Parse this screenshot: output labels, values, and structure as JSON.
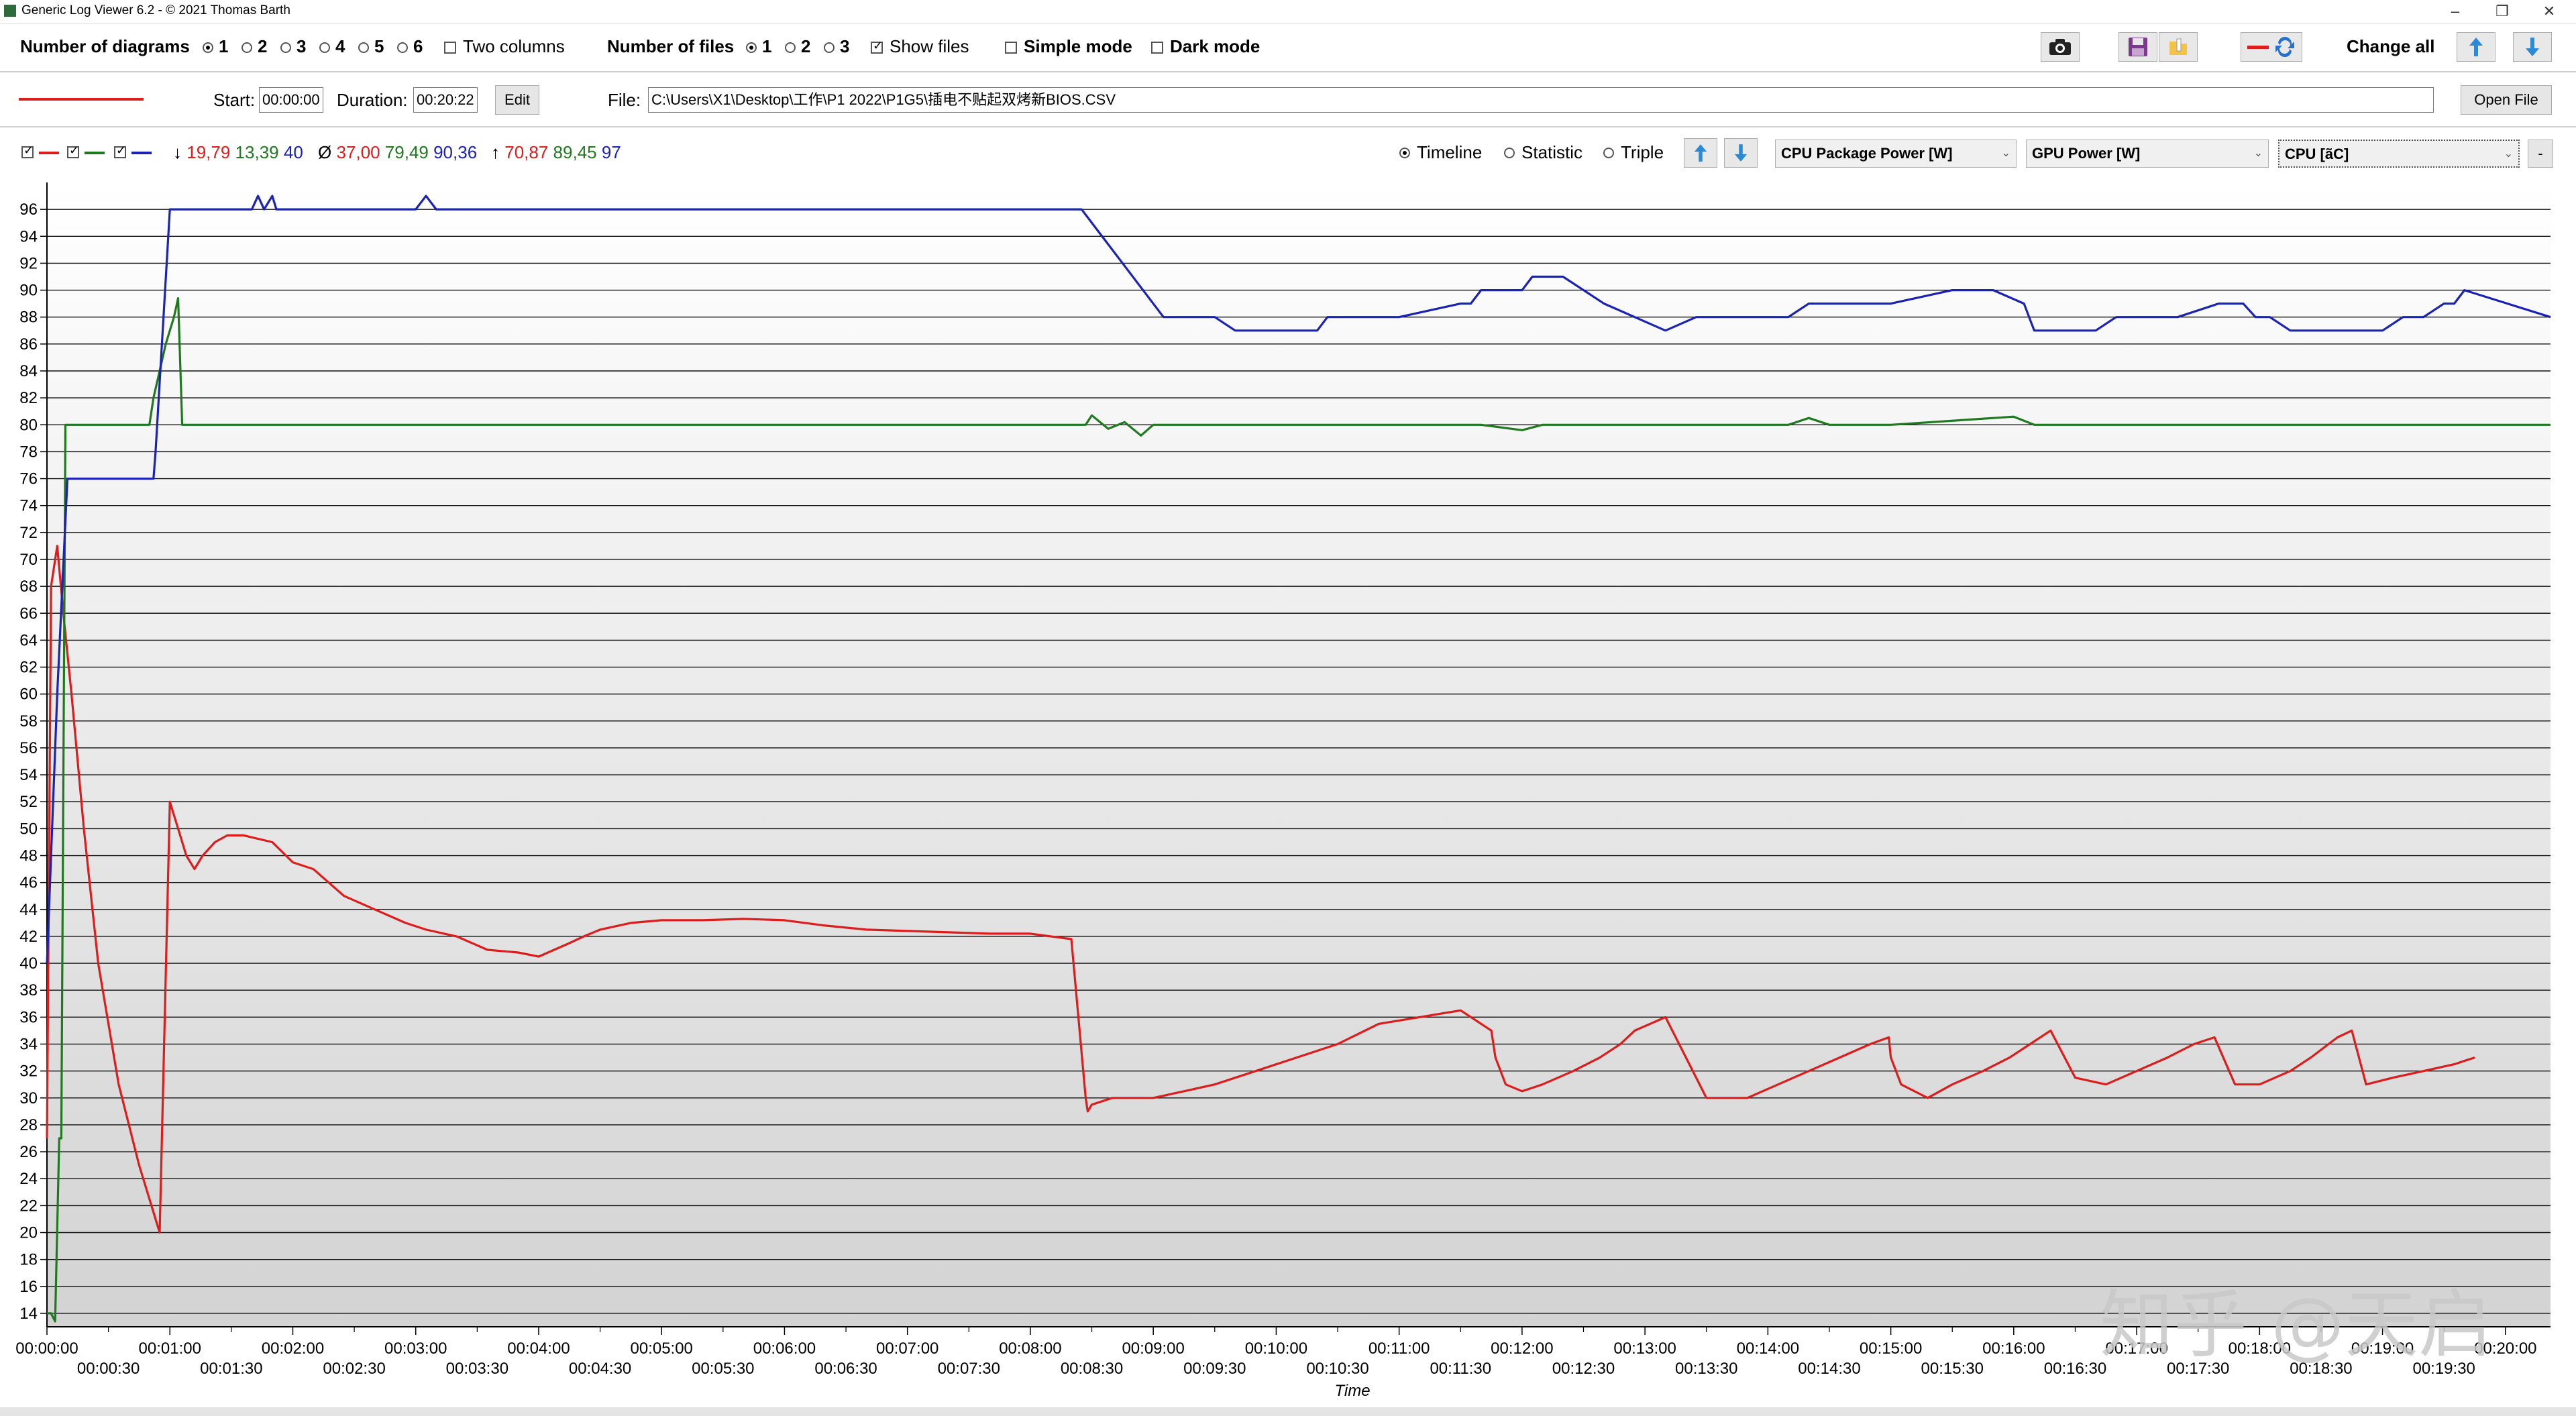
{
  "window": {
    "title": "Generic Log Viewer 6.2 - © 2021 Thomas Barth",
    "minimize": "–",
    "restore": "❐",
    "close": "✕"
  },
  "toolbar": {
    "diagrams_label": "Number of diagrams",
    "diagram_options": [
      "1",
      "2",
      "3",
      "4",
      "5",
      "6"
    ],
    "diagram_selected": "1",
    "two_columns_label": "Two columns",
    "files_label": "Number of files",
    "file_options": [
      "1",
      "2",
      "3"
    ],
    "file_selected": "1",
    "show_files_label": "Show files",
    "simple_mode_label": "Simple mode",
    "dark_mode_label": "Dark mode",
    "change_all_label": "Change all"
  },
  "file_row": {
    "line_color": "#dd1c1c",
    "start_label": "Start:",
    "start_value": "00:00:00",
    "duration_label": "Duration:",
    "duration_value": "00:20:22",
    "edit_label": "Edit",
    "file_label": "File:",
    "file_path": "C:\\Users\\X1\\Desktop\\工作\\P1 2022\\P1G5\\插电不贴起双烤新BIOS.CSV",
    "open_file_label": "Open File"
  },
  "stats": {
    "min_arrow": "↓",
    "min_red": "19,79",
    "min_green": "13,39",
    "min_blue": "40",
    "avg_symbol": "Ø",
    "avg_red": "37,00",
    "avg_green": "79,49",
    "avg_blue": "90,36",
    "max_arrow": "↑",
    "max_red": "70,87",
    "max_green": "89,45",
    "max_blue": "97"
  },
  "view": {
    "timeline_label": "Timeline",
    "statistic_label": "Statistic",
    "triple_label": "Triple",
    "selected": "Timeline"
  },
  "selects": {
    "red": "CPU Package Power [W]",
    "green": "GPU Power [W]",
    "blue": "CPU [ãC]",
    "minus": "-"
  },
  "colors": {
    "red": "#dd1c1c",
    "green": "#1f7a1f",
    "blue": "#1a23b4"
  },
  "watermark": "知乎 @天启",
  "chart_data": {
    "type": "line",
    "xlabel": "Time",
    "ylim": [
      13,
      98
    ],
    "xlim": [
      0,
      1222
    ],
    "yticks": [
      14,
      16,
      18,
      20,
      22,
      24,
      26,
      28,
      30,
      32,
      34,
      36,
      38,
      40,
      42,
      44,
      46,
      48,
      50,
      52,
      54,
      56,
      58,
      60,
      62,
      64,
      66,
      68,
      70,
      72,
      74,
      76,
      78,
      80,
      82,
      84,
      86,
      88,
      90,
      92,
      94,
      96
    ],
    "xticks_upper": [
      "00:00:00",
      "00:01:00",
      "00:02:00",
      "00:03:00",
      "00:04:00",
      "00:05:00",
      "00:06:00",
      "00:07:00",
      "00:08:00",
      "00:09:00",
      "00:10:00",
      "00:11:00",
      "00:12:00",
      "00:13:00",
      "00:14:00",
      "00:15:00",
      "00:16:00",
      "00:17:00",
      "00:18:00",
      "00:19:00",
      "00:20:00"
    ],
    "xticks_lower": [
      "00:00:30",
      "00:01:30",
      "00:02:30",
      "00:03:30",
      "00:04:30",
      "00:05:30",
      "00:06:30",
      "00:07:30",
      "00:08:30",
      "00:09:30",
      "00:10:30",
      "00:11:30",
      "00:12:30",
      "00:13:30",
      "00:14:30",
      "00:15:30",
      "00:16:30",
      "00:17:30",
      "00:18:30",
      "00:19:30"
    ],
    "grid": true,
    "series": [
      {
        "name": "CPU Package Power [W]",
        "color": "#dd1c1c",
        "x": [
          0,
          2,
          5,
          8,
          12,
          18,
          25,
          35,
          45,
          55,
          60,
          62,
          64,
          68,
          72,
          76,
          82,
          88,
          96,
          110,
          120,
          130,
          145,
          160,
          175,
          185,
          200,
          215,
          230,
          240,
          255,
          262,
          270,
          285,
          300,
          320,
          340,
          360,
          380,
          400,
          420,
          440,
          460,
          480,
          500,
          507,
          508,
          510,
          520,
          530,
          540,
          555,
          570,
          590,
          610,
          630,
          650,
          670,
          690,
          705,
          707,
          712,
          720,
          730,
          745,
          758,
          768,
          775,
          790,
          810,
          830,
          845,
          860,
          875,
          890,
          899,
          900,
          905,
          918,
          930,
          945,
          958,
          968,
          978,
          990,
          1005,
          1020,
          1035,
          1048,
          1058,
          1068,
          1080,
          1095,
          1105,
          1118,
          1125,
          1132,
          1145,
          1160,
          1175,
          1185
        ],
        "y": [
          27,
          68,
          71,
          66,
          60,
          50,
          40,
          31,
          25,
          20,
          52,
          51,
          50,
          48,
          47,
          48,
          49,
          49.5,
          49.5,
          49,
          47.5,
          47,
          45,
          44,
          43,
          42.5,
          42,
          41,
          40.8,
          40.5,
          41.5,
          42,
          42.5,
          43,
          43.2,
          43.2,
          43.3,
          43.2,
          42.8,
          42.5,
          42.4,
          42.3,
          42.2,
          42.2,
          41.8,
          30,
          29,
          29.5,
          30,
          30,
          30,
          30.5,
          31,
          32,
          33,
          34,
          35.5,
          36,
          36.5,
          35,
          33,
          31,
          30.5,
          31,
          32,
          33,
          34,
          35,
          36,
          30,
          30,
          31,
          32,
          33,
          34,
          34.5,
          33,
          31,
          30,
          31,
          32,
          33,
          34,
          35,
          31.5,
          31,
          32,
          33,
          34,
          34.5,
          31,
          31,
          32,
          33,
          34.5,
          35,
          31,
          31.5,
          32,
          32.5,
          33
        ]
      },
      {
        "name": "GPU Power [W]",
        "color": "#1f7a1f",
        "x": [
          0,
          2,
          4,
          6,
          7,
          9,
          20,
          40,
          50,
          52,
          55,
          58,
          62,
          64,
          66,
          68,
          70,
          75,
          100,
          200,
          300,
          400,
          500,
          507,
          510,
          518,
          526,
          534,
          540,
          560,
          600,
          700,
          720,
          730,
          800,
          850,
          860,
          870,
          900,
          960,
          970,
          980,
          1100,
          1222
        ],
        "y": [
          14,
          14,
          13.4,
          27,
          27,
          80,
          80,
          80,
          80,
          82,
          84,
          86,
          88,
          89.4,
          80,
          80,
          80,
          80,
          80,
          80,
          80,
          80,
          80,
          80,
          80.7,
          79.7,
          80.2,
          79.2,
          80,
          80,
          80,
          80,
          79.6,
          80,
          80,
          80,
          80.5,
          80,
          80,
          80.6,
          80,
          80,
          80,
          80
        ]
      },
      {
        "name": "CPU [ãC]",
        "color": "#1a23b4",
        "x": [
          0,
          5,
          10,
          52,
          53,
          60,
          62,
          100,
          103,
          106,
          110,
          112,
          180,
          185,
          190,
          240,
          500,
          505,
          545,
          550,
          555,
          570,
          580,
          590,
          610,
          620,
          625,
          640,
          660,
          690,
          695,
          700,
          710,
          720,
          725,
          740,
          760,
          790,
          805,
          815,
          840,
          850,
          860,
          880,
          900,
          930,
          935,
          950,
          965,
          970,
          975,
          1000,
          1010,
          1015,
          1040,
          1060,
          1072,
          1078,
          1085,
          1095,
          1140,
          1150,
          1160,
          1170,
          1175,
          1180,
          1222
        ],
        "y": [
          40,
          60,
          76,
          76,
          78,
          96,
          96,
          96,
          97,
          96,
          97,
          96,
          96,
          97,
          96,
          96,
          96,
          96,
          88,
          88,
          88,
          88,
          87,
          87,
          87,
          87,
          88,
          88,
          88,
          89,
          89,
          90,
          90,
          90,
          91,
          91,
          89,
          87,
          88,
          88,
          88,
          88,
          89,
          89,
          89,
          90,
          90,
          90,
          89,
          87,
          87,
          87,
          88,
          88,
          88,
          89,
          89,
          88,
          88,
          87,
          87,
          88,
          88,
          89,
          89,
          90,
          88
        ]
      }
    ]
  }
}
